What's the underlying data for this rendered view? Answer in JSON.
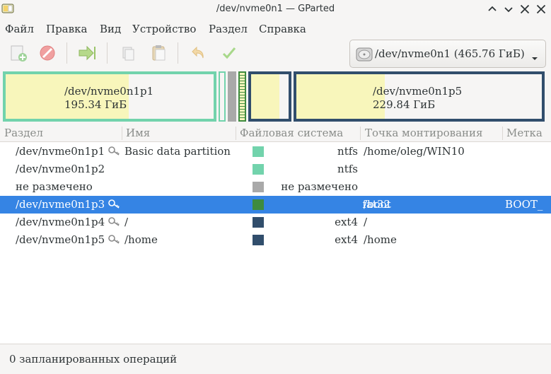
{
  "window": {
    "title": "/dev/nvme0n1 — GParted"
  },
  "menubar": {
    "items": [
      "Файл",
      "Правка",
      "Вид",
      "Устройство",
      "Раздел",
      "Справка"
    ]
  },
  "toolbar": {
    "buttons": [
      "new-partition",
      "delete-partition",
      "resize-move",
      "copy",
      "paste",
      "undo",
      "apply"
    ],
    "device_selector": "/dev/nvme0n1 (465.76 ГиБ)"
  },
  "diskmap": {
    "partitions": [
      {
        "name": "/dev/nvme0n1p1",
        "size": "195.34 ГиБ",
        "color": "#72d3ac"
      },
      {
        "name": "/dev/nvme0n1p2",
        "size": "",
        "color": "#72d3ac"
      },
      {
        "name": "не размечено",
        "size": "",
        "color": "#a9a9a9"
      },
      {
        "name": "/dev/nvme0n1p3",
        "size": "",
        "color": "#3e8b3e"
      },
      {
        "name": "/dev/nvme0n1p4",
        "size": "",
        "color": "#314e6c"
      },
      {
        "name": "/dev/nvme0n1p5",
        "size": "229.84 ГиБ",
        "color": "#314e6c"
      }
    ]
  },
  "table": {
    "columns": [
      "Раздел",
      "Имя",
      "Файловая система",
      "Точка монтирования",
      "Метка"
    ],
    "rows": [
      {
        "partition": "/dev/nvme0n1p1",
        "key": true,
        "name": "Basic data partition",
        "fs": "ntfs",
        "fs_color": "#72d3ac",
        "mount": "/home/oleg/WIN10",
        "label": "",
        "selected": false
      },
      {
        "partition": "/dev/nvme0n1p2",
        "key": false,
        "name": "",
        "fs": "ntfs",
        "fs_color": "#72d3ac",
        "mount": "",
        "label": "",
        "selected": false
      },
      {
        "partition": "не размечено",
        "key": false,
        "name": "",
        "fs": "не размечено",
        "fs_color": "#a9a9a9",
        "mount": "",
        "label": "",
        "selected": false
      },
      {
        "partition": "/dev/nvme0n1p3",
        "key": true,
        "name": "",
        "fs": "fat32",
        "fs_color": "#3e8b3e",
        "mount": "/boot",
        "label": "BOOT_",
        "selected": true
      },
      {
        "partition": "/dev/nvme0n1p4",
        "key": true,
        "name": "/",
        "fs": "ext4",
        "fs_color": "#314e6c",
        "mount": "/",
        "label": "",
        "selected": false
      },
      {
        "partition": "/dev/nvme0n1p5",
        "key": true,
        "name": "/home",
        "fs": "ext4",
        "fs_color": "#314e6c",
        "mount": "/home",
        "label": "",
        "selected": false
      }
    ]
  },
  "statusbar": {
    "text": "0 запланированных операций"
  },
  "colors": {
    "selection": "#3584e4",
    "used_space": "#f8f6bb",
    "ntfs": "#72d3ac",
    "fat32": "#3e8b3e",
    "ext4": "#314e6c",
    "unallocated": "#a9a9a9"
  }
}
